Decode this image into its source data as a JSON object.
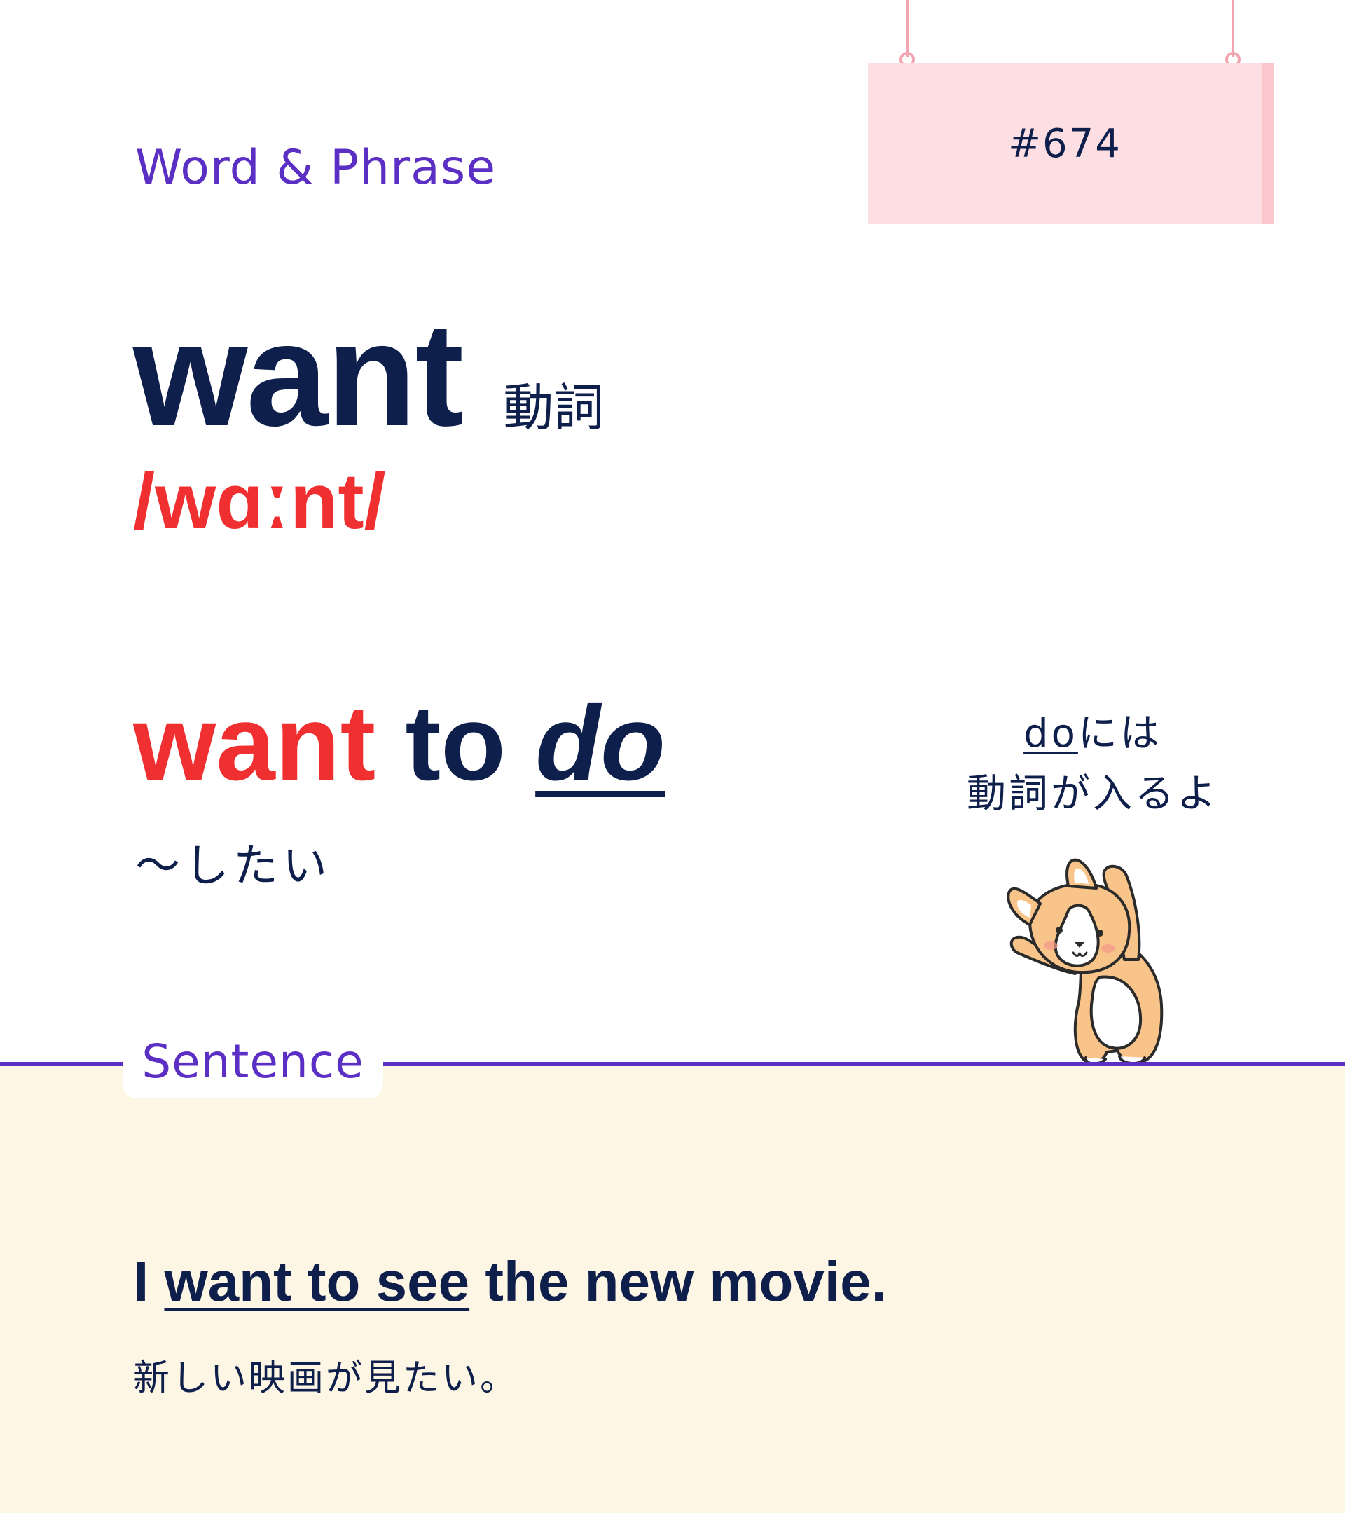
{
  "header": {
    "section_label": "Word & Phrase",
    "entry_number": "#674"
  },
  "entry": {
    "headword": "want",
    "part_of_speech": "動詞",
    "pronunciation": "/wɑːnt/"
  },
  "phrase": {
    "part1": "want",
    "part2": "to",
    "part3": "do",
    "meaning": "～したい"
  },
  "note": {
    "line1_underlined": "do",
    "line1_rest": "には",
    "line2": "動詞が入るよ"
  },
  "example": {
    "section_label": "Sentence",
    "sentence_start": "I ",
    "sentence_highlight": "want to see",
    "sentence_end": " the new movie.",
    "translation": "新しい映画が見たい。"
  },
  "colors": {
    "navy": "#0f1f4b",
    "red": "#f03030",
    "purple": "#5b2fc4",
    "sign_pink": "#fddfe3",
    "panel_cream": "#fdf6e4"
  },
  "icons": {
    "mascot": "corgi-mascot-icon"
  }
}
